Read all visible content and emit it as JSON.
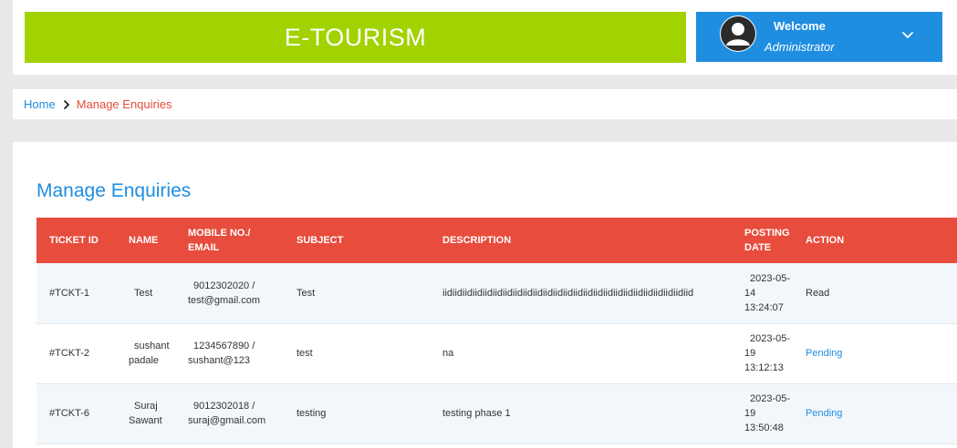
{
  "header": {
    "brand": "E-TOURISM",
    "welcome": "Welcome",
    "user_role": "Administrator"
  },
  "breadcrumb": {
    "home": "Home",
    "current": "Manage Enquiries"
  },
  "page": {
    "title": "Manage Enquiries"
  },
  "table": {
    "headers": {
      "ticket_id": "TICKET ID",
      "name": "NAME",
      "mobile_line1": "MOBILE NO./",
      "mobile_line2": "EMAIL",
      "subject": "SUBJECT",
      "description": "DESCRIPTION",
      "date_line1": "POSTING",
      "date_line2": "DATE",
      "action": "ACTION"
    },
    "rows": [
      {
        "ticket_id": "#TCKT-1",
        "name_line1": "Test",
        "name_line2": "",
        "mobile_line1": "9012302020 /",
        "mobile_line2": "test@gmail.com",
        "subject": "Test",
        "description": "iidiidiidiidiidiidiidiidiidiidiidiidiidiidiidiidiidiidiidiidiidiidiidiidiid",
        "date_line1": "2023-05-",
        "date_line2": "14",
        "date_line3": "13:24:07",
        "action": "Read"
      },
      {
        "ticket_id": "#TCKT-2",
        "name_line1": "sushant",
        "name_line2": "padale",
        "mobile_line1": "1234567890 /",
        "mobile_line2": "sushant@123",
        "subject": "test",
        "description": "na",
        "date_line1": "2023-05-",
        "date_line2": "19",
        "date_line3": "13:12:13",
        "action": "Pending"
      },
      {
        "ticket_id": "#TCKT-6",
        "name_line1": "Suraj",
        "name_line2": "Sawant",
        "mobile_line1": "9012302018 /",
        "mobile_line2": "suraj@gmail.com",
        "subject": "testing",
        "description": "testing phase 1",
        "date_line1": "2023-05-",
        "date_line2": "19",
        "date_line3": "13:50:48",
        "action": "Pending"
      }
    ]
  },
  "colors": {
    "brand_green": "#a2d200",
    "accent_blue": "#1f8ee0",
    "header_red": "#e74c3c"
  },
  "icons": {
    "avatar": "user-avatar-icon",
    "dropdown": "chevron-down-icon",
    "breadcrumb_separator": "chevron-right-icon"
  }
}
